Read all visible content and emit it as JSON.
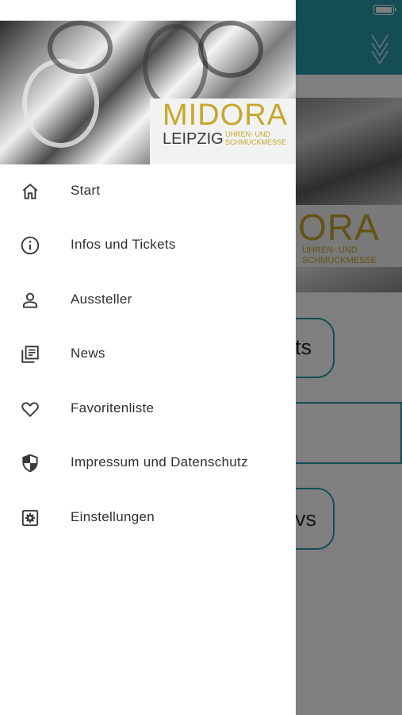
{
  "background": {
    "hero": {
      "title": "ORA",
      "subtitle_line1": "UHREN- UND",
      "subtitle_line2": "SCHMUCKMESSE"
    },
    "buttons": [
      {
        "label": "ts"
      },
      {
        "label": ""
      },
      {
        "label": "vs"
      }
    ],
    "colors": {
      "topbar": "#2a9aab",
      "brand_gold": "#c7a72a"
    }
  },
  "drawer": {
    "header": {
      "title": "MIDORA",
      "city": "LEIPZIG",
      "subtitle_line1": "UHREN- UND",
      "subtitle_line2": "SCHMUCKMESSE"
    },
    "items": [
      {
        "label": "Start",
        "icon": "home-icon"
      },
      {
        "label": "Infos und Tickets",
        "icon": "info-icon"
      },
      {
        "label": "Aussteller",
        "icon": "person-icon"
      },
      {
        "label": "News",
        "icon": "news-icon"
      },
      {
        "label": "Favoritenliste",
        "icon": "heart-icon"
      },
      {
        "label": "Impressum und Datenschutz",
        "icon": "shield-icon"
      },
      {
        "label": "Einstellungen",
        "icon": "settings-icon"
      }
    ]
  }
}
